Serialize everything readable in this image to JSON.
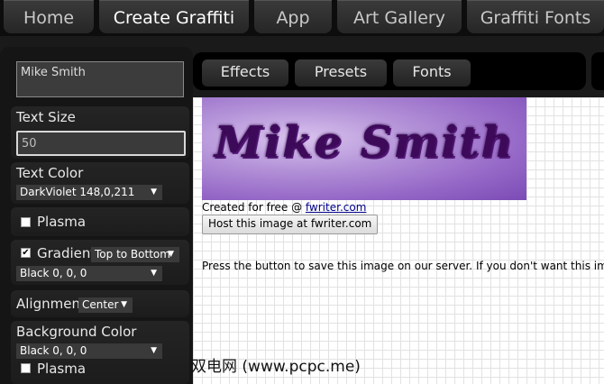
{
  "nav": {
    "tabs": [
      "Home",
      "Create Graffiti",
      "App",
      "Art Gallery",
      "Graffiti Fonts"
    ]
  },
  "panel": {
    "name_value": "Mike Smith",
    "text_size_label": "Text Size",
    "text_size_value": "50",
    "text_color_label": "Text Color",
    "text_color_value": "DarkViolet 148,0,211",
    "plasma_label": "Plasma",
    "gradient_label": "Gradient",
    "gradient_direction": "Top to Bottom",
    "gradient_color": "Black 0, 0, 0",
    "alignment_label": "Alignment",
    "alignment_value": "Center",
    "bg_color_label": "Background Color",
    "bg_color_value": "Black 0, 0, 0",
    "bg_plasma_label": "Plasma"
  },
  "subtabs": [
    "Effects",
    "Presets",
    "Fonts"
  ],
  "preview": {
    "graffiti_text": "Mike  Smith",
    "created_prefix": "Created for free @ ",
    "created_link": "fwriter.com",
    "host_button": "Host this image at fwriter.com",
    "save_text": "Press the button to save this image on our server. If you don't want this image"
  },
  "watermark": "双电网 (www.pcpc.me)",
  "colors": {
    "accent_purple": "#9400d3",
    "panel_bg": "#1a1a1a"
  }
}
